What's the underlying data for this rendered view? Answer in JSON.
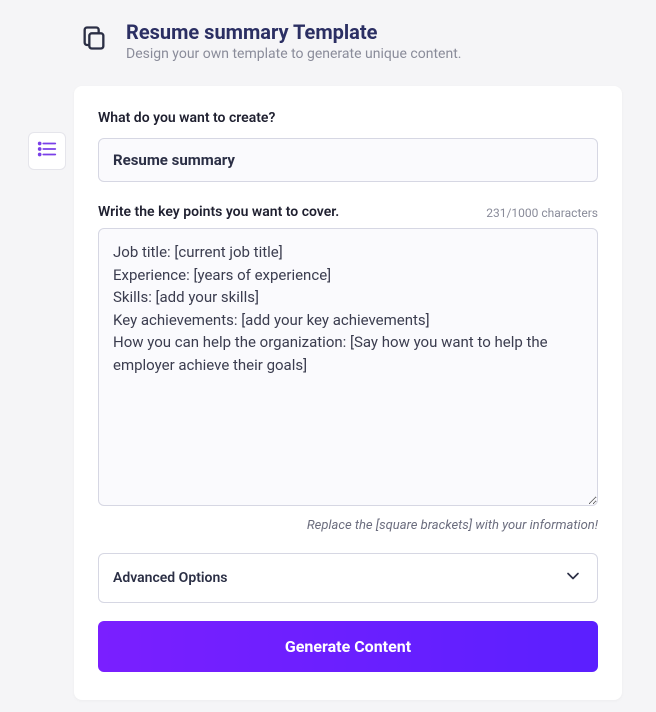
{
  "header": {
    "title": "Resume summary Template",
    "subtitle": "Design your own template to generate unique content."
  },
  "form": {
    "create_label": "What do you want to create?",
    "create_value": "Resume summary",
    "keypoints_label": "Write the key points you want to cover.",
    "char_counter": "231/1000 characters",
    "keypoints_value": "Job title: [current job title]\nExperience: [years of experience]\nSkills: [add your skills]\nKey achievements: [add your key achievements]\nHow you can help the organization: [Say how you want to help the employer achieve their goals]",
    "hint_text": "Replace the [square brackets] with your information!",
    "advanced_label": "Advanced Options",
    "generate_label": "Generate Content"
  }
}
